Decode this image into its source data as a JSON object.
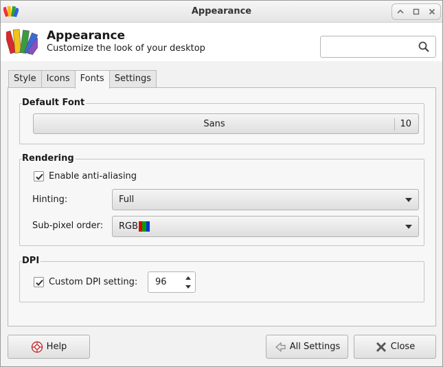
{
  "window": {
    "title": "Appearance"
  },
  "header": {
    "title": "Appearance",
    "subtitle": "Customize the look of your desktop",
    "search_placeholder": ""
  },
  "tabs": [
    {
      "label": "Style"
    },
    {
      "label": "Icons"
    },
    {
      "label": "Fonts"
    },
    {
      "label": "Settings"
    }
  ],
  "active_tab": "Fonts",
  "default_font": {
    "section_label": "Default Font",
    "name": "Sans",
    "size": "10"
  },
  "rendering": {
    "section_label": "Rendering",
    "antialias_label": "Enable anti-aliasing",
    "antialias_checked": true,
    "hinting_label": "Hinting:",
    "hinting_value": "Full",
    "subpixel_label": "Sub-pixel order:",
    "subpixel_value": "RGB",
    "rgb_colors": [
      "#e00000",
      "#00a000",
      "#0030e0"
    ]
  },
  "dpi": {
    "section_label": "DPI",
    "custom_label": "Custom DPI setting:",
    "custom_checked": true,
    "value": "96"
  },
  "footer": {
    "help_label": "Help",
    "all_settings_label": "All Settings",
    "close_label": "Close"
  }
}
